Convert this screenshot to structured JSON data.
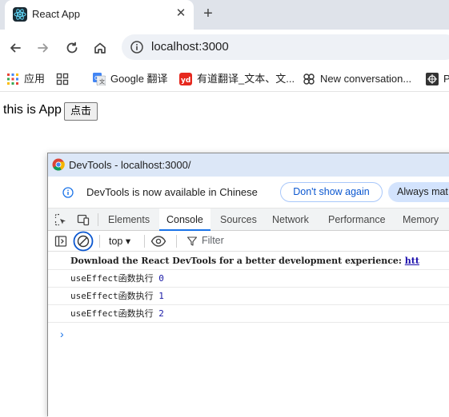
{
  "browser": {
    "tab_title": "React App",
    "close_glyph": "✕",
    "new_tab_glyph": "+",
    "url": "localhost:3000"
  },
  "bookmarks": [
    {
      "label": "应用",
      "icon": "apps-grid-icon"
    },
    {
      "label": "",
      "icon": "tab-groups-icon"
    },
    {
      "label": "Google 翻译",
      "icon": "google-translate-icon"
    },
    {
      "label": "有道翻译_文本、文...",
      "icon": "youdao-icon"
    },
    {
      "label": "New conversation...",
      "icon": "chat-ai-icon"
    },
    {
      "label": "P",
      "icon": "extension-icon"
    }
  ],
  "page": {
    "text": "this is App",
    "button_label": "点击"
  },
  "devtools": {
    "window_title": "DevTools - localhost:3000/",
    "info_message": "DevTools is now available in Chinese",
    "dont_show_label": "Don't show again",
    "always_match_label": "Always mat",
    "tabs": [
      "Elements",
      "Console",
      "Sources",
      "Network",
      "Performance",
      "Memory"
    ],
    "active_tab": "Console",
    "context": "top ▾",
    "filter_label": "Filter",
    "console_lines": [
      {
        "text": "Download the React DevTools for a better development experience: ",
        "link": "htt"
      },
      {
        "text": "useEffect函数执行 ",
        "value": "0"
      },
      {
        "text": "useEffect函数执行 ",
        "value": "1"
      },
      {
        "text": "useEffect函数执行 ",
        "value": "2"
      }
    ],
    "prompt_glyph": "›"
  },
  "colors": {
    "accent": "#1a73e8",
    "tabstrip": "#dfe3ea",
    "devtools_titlebar": "#dce7f7"
  }
}
